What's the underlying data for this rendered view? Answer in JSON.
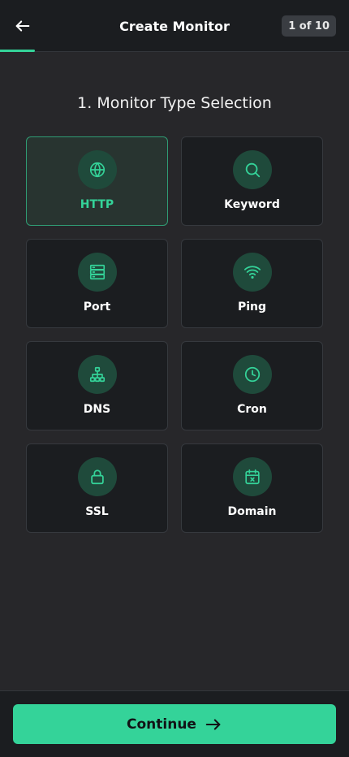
{
  "header": {
    "title": "Create Monitor",
    "step_badge": "1 of 10",
    "progress": 0.1
  },
  "section": {
    "title": "1. Monitor Type Selection"
  },
  "monitor_types": [
    {
      "label": "HTTP",
      "icon": "globe-icon",
      "selected": true
    },
    {
      "label": "Keyword",
      "icon": "search-icon",
      "selected": false
    },
    {
      "label": "Port",
      "icon": "server-icon",
      "selected": false
    },
    {
      "label": "Ping",
      "icon": "wifi-icon",
      "selected": false
    },
    {
      "label": "DNS",
      "icon": "network-icon",
      "selected": false
    },
    {
      "label": "Cron",
      "icon": "clock-icon",
      "selected": false
    },
    {
      "label": "SSL",
      "icon": "lock-icon",
      "selected": false
    },
    {
      "label": "Domain",
      "icon": "calendar-x-icon",
      "selected": false
    }
  ],
  "footer": {
    "continue_label": "Continue"
  },
  "colors": {
    "accent": "#34d399",
    "background": "#27272a",
    "surface": "#1b1d20",
    "icon_bg": "#1f4a3b"
  }
}
